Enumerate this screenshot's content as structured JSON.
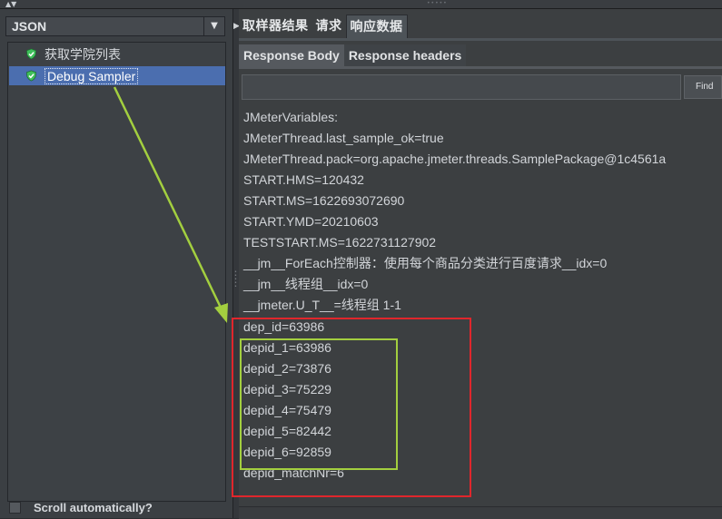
{
  "left_panel": {
    "renderer_combo": {
      "value": "JSON"
    },
    "tree": [
      {
        "label": "获取学院列表",
        "selected": false
      },
      {
        "label": "Debug Sampler",
        "selected": true
      }
    ],
    "scroll_automatically": {
      "label": "Scroll automatically?",
      "checked": false
    }
  },
  "tabs_top": [
    {
      "label": "取样器结果",
      "active": false
    },
    {
      "label": "请求",
      "active": false
    },
    {
      "label": "响应数据",
      "active": true
    }
  ],
  "tabs_sub": [
    {
      "label": "Response Body",
      "active": true
    },
    {
      "label": "Response headers",
      "active": false
    }
  ],
  "find": {
    "button_label": "Find",
    "value": ""
  },
  "response_lines": [
    "JMeterVariables:",
    "JMeterThread.last_sample_ok=true",
    "JMeterThread.pack=org.apache.jmeter.threads.SamplePackage@1c4561a",
    "START.HMS=120432",
    "START.MS=1622693072690",
    "START.YMD=20210603",
    "TESTSTART.MS=1622731127902",
    "__jm__ForEach控制器：使用每个商品分类进行百度请求__idx=0",
    "__jm__线程组__idx=0",
    "__jmeter.U_T__=线程组 1-1",
    "dep_id=63986",
    "depid_1=63986",
    "depid_2=73876",
    "depid_3=75229",
    "depid_4=75479",
    "depid_5=82442",
    "depid_6=92859",
    "depid_matchNr=6"
  ],
  "colors": {
    "selection": "#4b6eaf",
    "annotation_red": "#e0262c",
    "annotation_green": "#a3cf3f",
    "shield_green": "#3fbf5a"
  },
  "icons": {
    "tree_item": "shield-check-icon",
    "combo_arrow": "caret-down-icon",
    "splitter": "collapse-arrows-icon"
  }
}
